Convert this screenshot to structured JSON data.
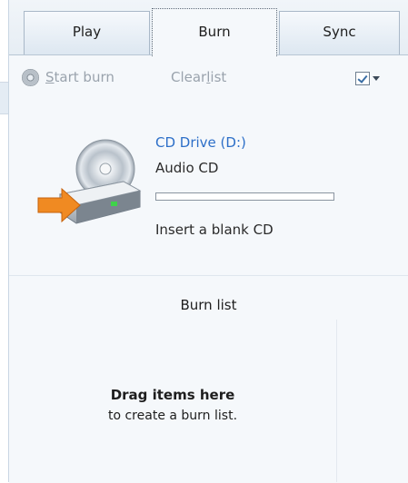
{
  "tabs": [
    {
      "label": "Play"
    },
    {
      "label": "Burn",
      "selected": true
    },
    {
      "label": "Sync"
    }
  ],
  "toolbar": {
    "start_burn_prefix": "S",
    "start_burn_rest": "tart burn",
    "clear_list_prefix": "Clear ",
    "clear_list_underline": "l",
    "clear_list_rest": "ist",
    "options_icon": "checkbox-list-icon"
  },
  "device": {
    "name": "CD Drive (D:)",
    "media": "Audio CD",
    "progress": 0,
    "status": "Insert a blank CD"
  },
  "burn_list": {
    "title": "Burn list",
    "empty_title": "Drag items here",
    "empty_subtitle": "to create a burn list."
  },
  "colors": {
    "link_blue": "#2d6fc8",
    "disabled_text": "#9aa3ad",
    "panel_bg": "#f5f8fb",
    "tab_border": "#a9b8c8"
  }
}
